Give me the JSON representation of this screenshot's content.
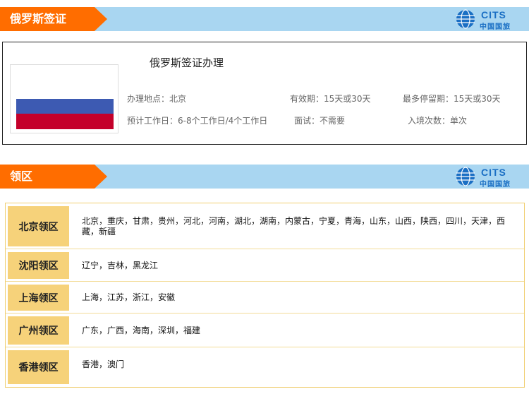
{
  "header": {
    "title": "俄罗斯签证"
  },
  "brand": {
    "name_en": "CITS",
    "name_zh": "中国国旅",
    "accent": "#ff6d00",
    "bar_color": "#a9d6f1",
    "logo_color": "#1a6fc4"
  },
  "visa": {
    "title": "俄罗斯签证办理",
    "location": "办理地点：北京",
    "validity": "有效期：15天或30天",
    "max_stay": "最多停留期：15天或30天",
    "working_days": "预计工作日：6-8个工作日/4个工作日",
    "interview": "面试：不需要",
    "entries": "入境次数：单次",
    "flag_colors": [
      "#ffffff",
      "#3d5ab2",
      "#c4002a"
    ]
  },
  "regions_header": {
    "title": "领区"
  },
  "regions": [
    {
      "name": "北京领区",
      "areas": "北京，重庆，甘肃，贵州，河北，河南，湖北，湖南，内蒙古，宁夏，青海，山东，山西，陕西，四川，天津，西藏，新疆"
    },
    {
      "name": "沈阳领区",
      "areas": "辽宁，吉林，黑龙江"
    },
    {
      "name": "上海领区",
      "areas": "上海，江苏，浙江，安徽"
    },
    {
      "name": "广州领区",
      "areas": "广东，广西，海南，深圳，福建"
    },
    {
      "name": "香港领区",
      "areas": "香港，澳门"
    }
  ]
}
